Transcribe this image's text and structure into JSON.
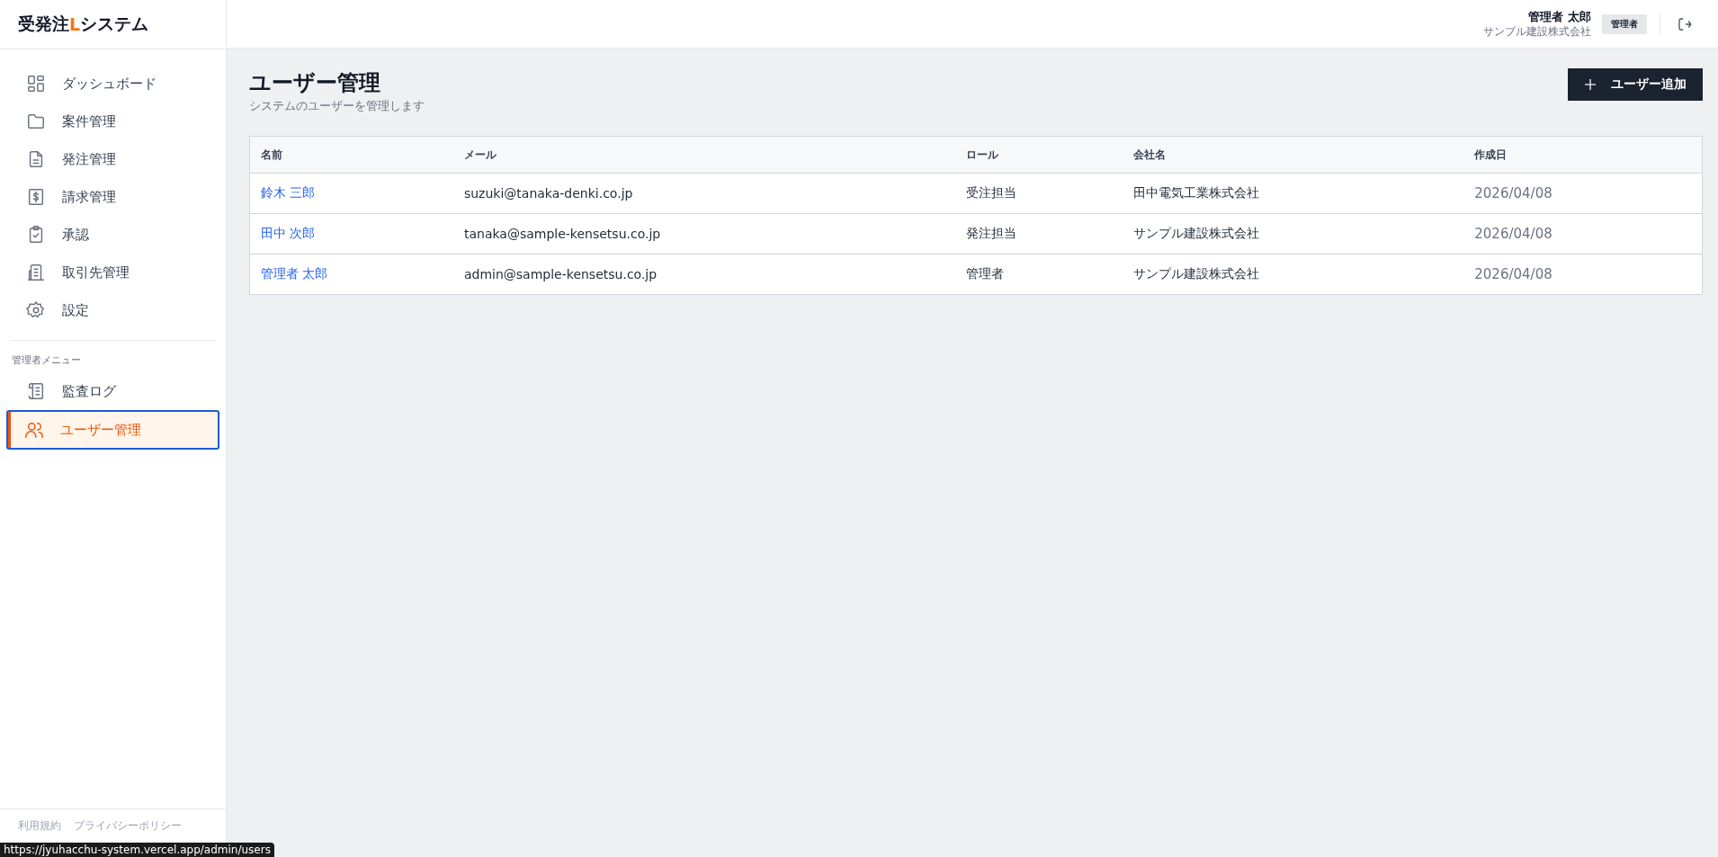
{
  "app": {
    "logo_before": "受発注",
    "logo_mark": "L",
    "logo_after": "システム"
  },
  "sidebar": {
    "items": [
      {
        "label": "ダッシュボード",
        "selected": false
      },
      {
        "label": "案件管理",
        "selected": false
      },
      {
        "label": "発注管理",
        "selected": false
      },
      {
        "label": "請求管理",
        "selected": false
      },
      {
        "label": "承認",
        "selected": false
      },
      {
        "label": "取引先管理",
        "selected": false
      },
      {
        "label": "設定",
        "selected": false
      }
    ],
    "admin_heading": "管理者メニュー",
    "admin_items": [
      {
        "label": "監査ログ",
        "selected": false
      },
      {
        "label": "ユーザー管理",
        "selected": true
      }
    ],
    "footer_links": [
      "利用規約",
      "プライバシーポリシー"
    ]
  },
  "header": {
    "user_name": "管理者 太郎",
    "company": "サンプル建設株式会社",
    "role_badge": "管理者"
  },
  "page": {
    "title": "ユーザー管理",
    "subtitle": "システムのユーザーを管理します",
    "add_button": "ユーザー追加"
  },
  "table": {
    "columns": [
      "名前",
      "メール",
      "ロール",
      "会社名",
      "作成日"
    ],
    "rows": [
      [
        "鈴木 三郎",
        "suzuki@tanaka-denki.co.jp",
        "受注担当",
        "田中電気工業株式会社",
        "2026/04/08"
      ],
      [
        "田中 次郎",
        "tanaka@sample-kensetsu.co.jp",
        "発注担当",
        "サンプル建設株式会社",
        "2026/04/08"
      ],
      [
        "管理者 太郎",
        "admin@sample-kensetsu.co.jp",
        "管理者",
        "サンプル建設株式会社",
        "2026/04/08"
      ]
    ]
  },
  "status_url": "https://jyuhacchu-system.vercel.app/admin/users"
}
